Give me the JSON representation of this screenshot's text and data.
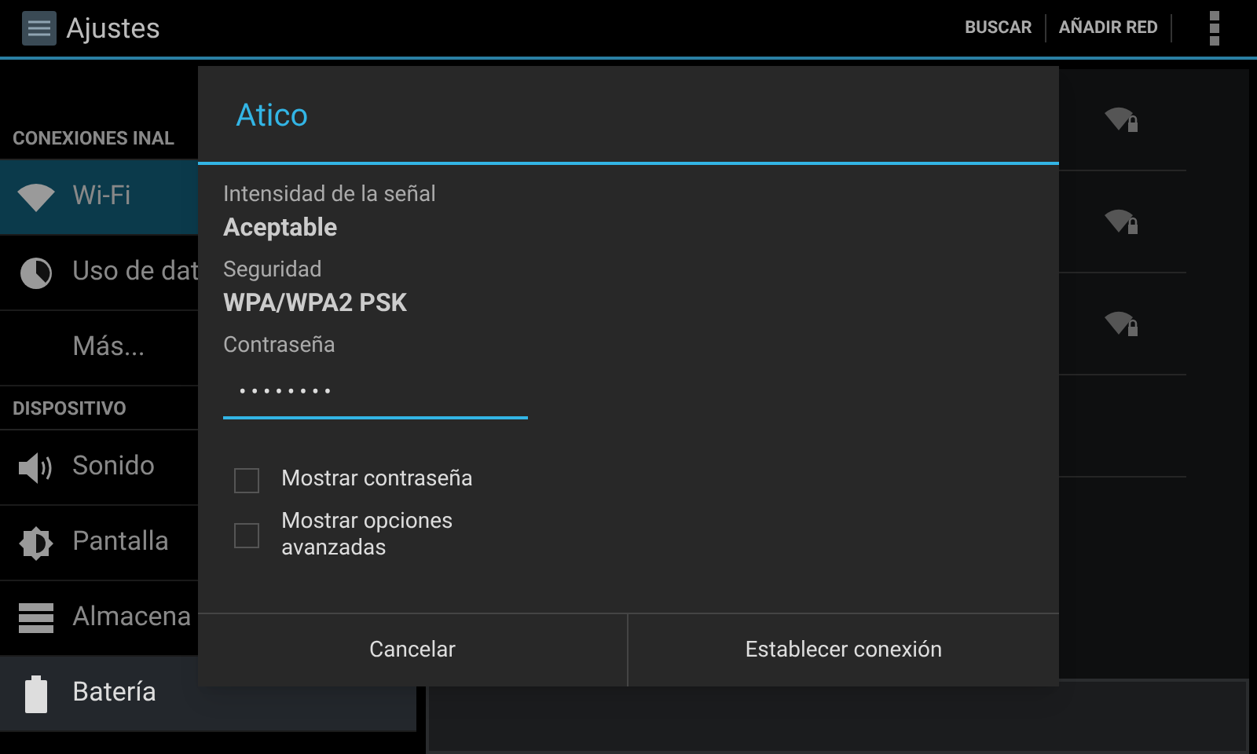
{
  "action_bar": {
    "title": "Ajustes",
    "actions": [
      "BUSCAR",
      "AÑADIR RED"
    ]
  },
  "sidebar": {
    "sections": [
      {
        "header": "CONEXIONES INAL",
        "items": [
          {
            "label": "Wi-Fi",
            "selected": true,
            "pressed": false
          },
          {
            "label": "Uso de dat",
            "selected": false,
            "pressed": false
          },
          {
            "label": "Más...",
            "selected": false,
            "pressed": false
          }
        ]
      },
      {
        "header": "DISPOSITIVO",
        "items": [
          {
            "label": "Sonido",
            "selected": false,
            "pressed": false
          },
          {
            "label": "Pantalla",
            "selected": false,
            "pressed": false
          },
          {
            "label": "Almacena",
            "selected": false,
            "pressed": false
          },
          {
            "label": "Batería",
            "selected": false,
            "pressed": true
          }
        ]
      }
    ]
  },
  "dialog": {
    "title": "Atico",
    "fields": [
      {
        "label": "Intensidad de la señal",
        "value": "Aceptable"
      },
      {
        "label": "Seguridad",
        "value": "WPA/WPA2 PSK"
      }
    ],
    "password": {
      "label": "Contraseña",
      "value": "••••••••"
    },
    "checkboxes": [
      {
        "label": "Mostrar contraseña",
        "checked": false
      },
      {
        "label": "Mostrar opciones avanzadas",
        "checked": false
      }
    ],
    "buttons": [
      "Cancelar",
      "Establecer conexión"
    ]
  }
}
